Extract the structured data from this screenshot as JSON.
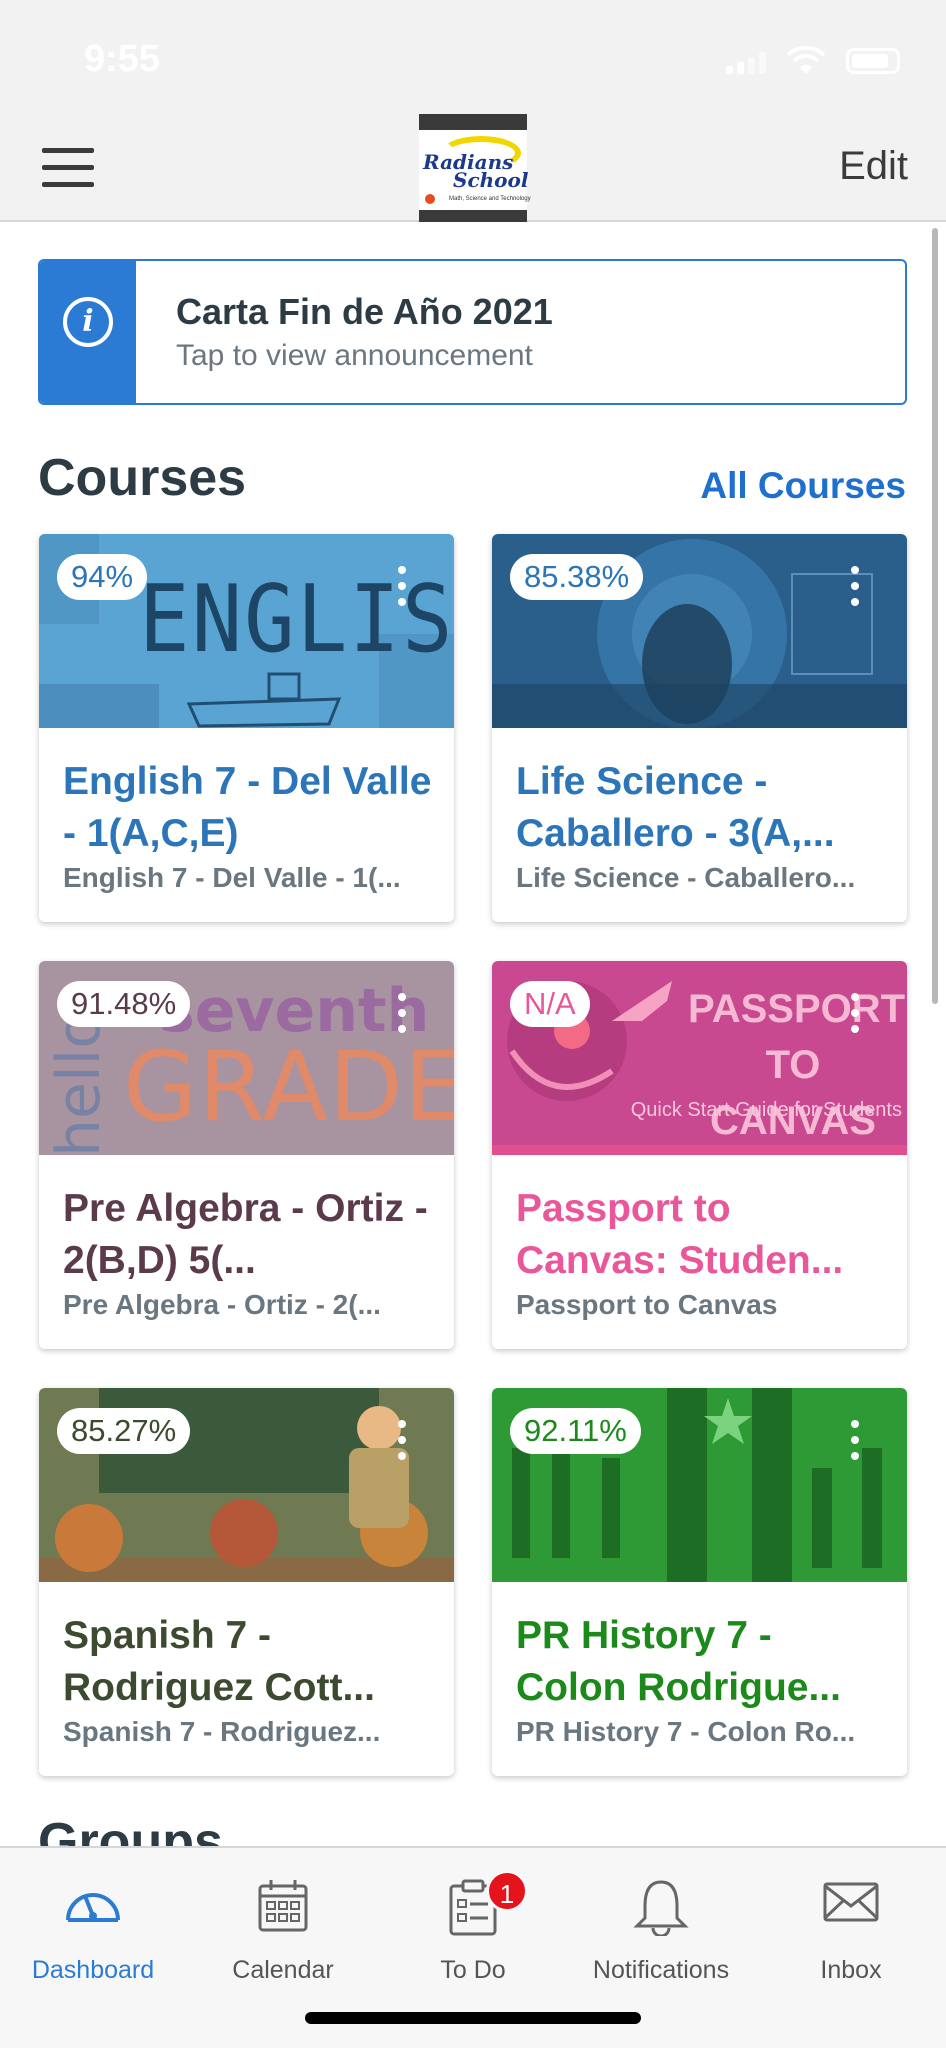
{
  "status_bar": {
    "time": "9:55"
  },
  "nav": {
    "logo_line1": "Radians",
    "logo_line2": "School",
    "logo_sub": "Math, Science and Technology",
    "edit_label": "Edit"
  },
  "announcement": {
    "title": "Carta Fin de Año 2021",
    "subtitle": "Tap to view announcement",
    "icon": "info-icon"
  },
  "courses": {
    "title": "Courses",
    "all_label": "All Courses",
    "items": [
      {
        "grade": "94%",
        "name": "English 7 - Del Valle - 1(A,C,E)",
        "code": "English 7 - Del Valle - 1(...",
        "color": "#2b75b8",
        "image_text": "ENGLISH"
      },
      {
        "grade": "85.38%",
        "name": "Life Science - Caballero - 3(A,...",
        "code": "Life Science - Caballero...",
        "color": "#2b75b8",
        "image_text": ""
      },
      {
        "grade": "91.48%",
        "name": "Pre Algebra - Ortiz - 2(B,D) 5(...",
        "code": "Pre Algebra - Ortiz - 2(...",
        "color": "#5b3b4b",
        "image_text": "GRADE"
      },
      {
        "grade": "N/A",
        "name": "Passport to Canvas: Studen...",
        "code": "Passport to Canvas",
        "color": "#e9579a",
        "image_text": "PASSPORT TO CANVAS",
        "image_sub": "Quick Start Guide for Students"
      },
      {
        "grade": "85.27%",
        "name": "Spanish 7 - Rodriguez Cott...",
        "code": "Spanish 7 - Rodriguez...",
        "color": "#3c4a2f",
        "image_text": ""
      },
      {
        "grade": "92.11%",
        "name": "PR History 7 - Colon Rodrigue...",
        "code": "PR History 7 - Colon Ro...",
        "color": "#1b8a1b",
        "image_text": ""
      }
    ]
  },
  "groups_peek": "Groups",
  "tabbar": {
    "items": [
      {
        "label": "Dashboard",
        "icon": "dashboard-icon",
        "active": true
      },
      {
        "label": "Calendar",
        "icon": "calendar-icon"
      },
      {
        "label": "To Do",
        "icon": "todo-icon",
        "badge": "1"
      },
      {
        "label": "Notifications",
        "icon": "bell-icon"
      },
      {
        "label": "Inbox",
        "icon": "envelope-icon"
      }
    ]
  },
  "colors": {
    "accent": "#2b7bd4",
    "link": "#1f6fcf",
    "badge": "#e5141c"
  }
}
